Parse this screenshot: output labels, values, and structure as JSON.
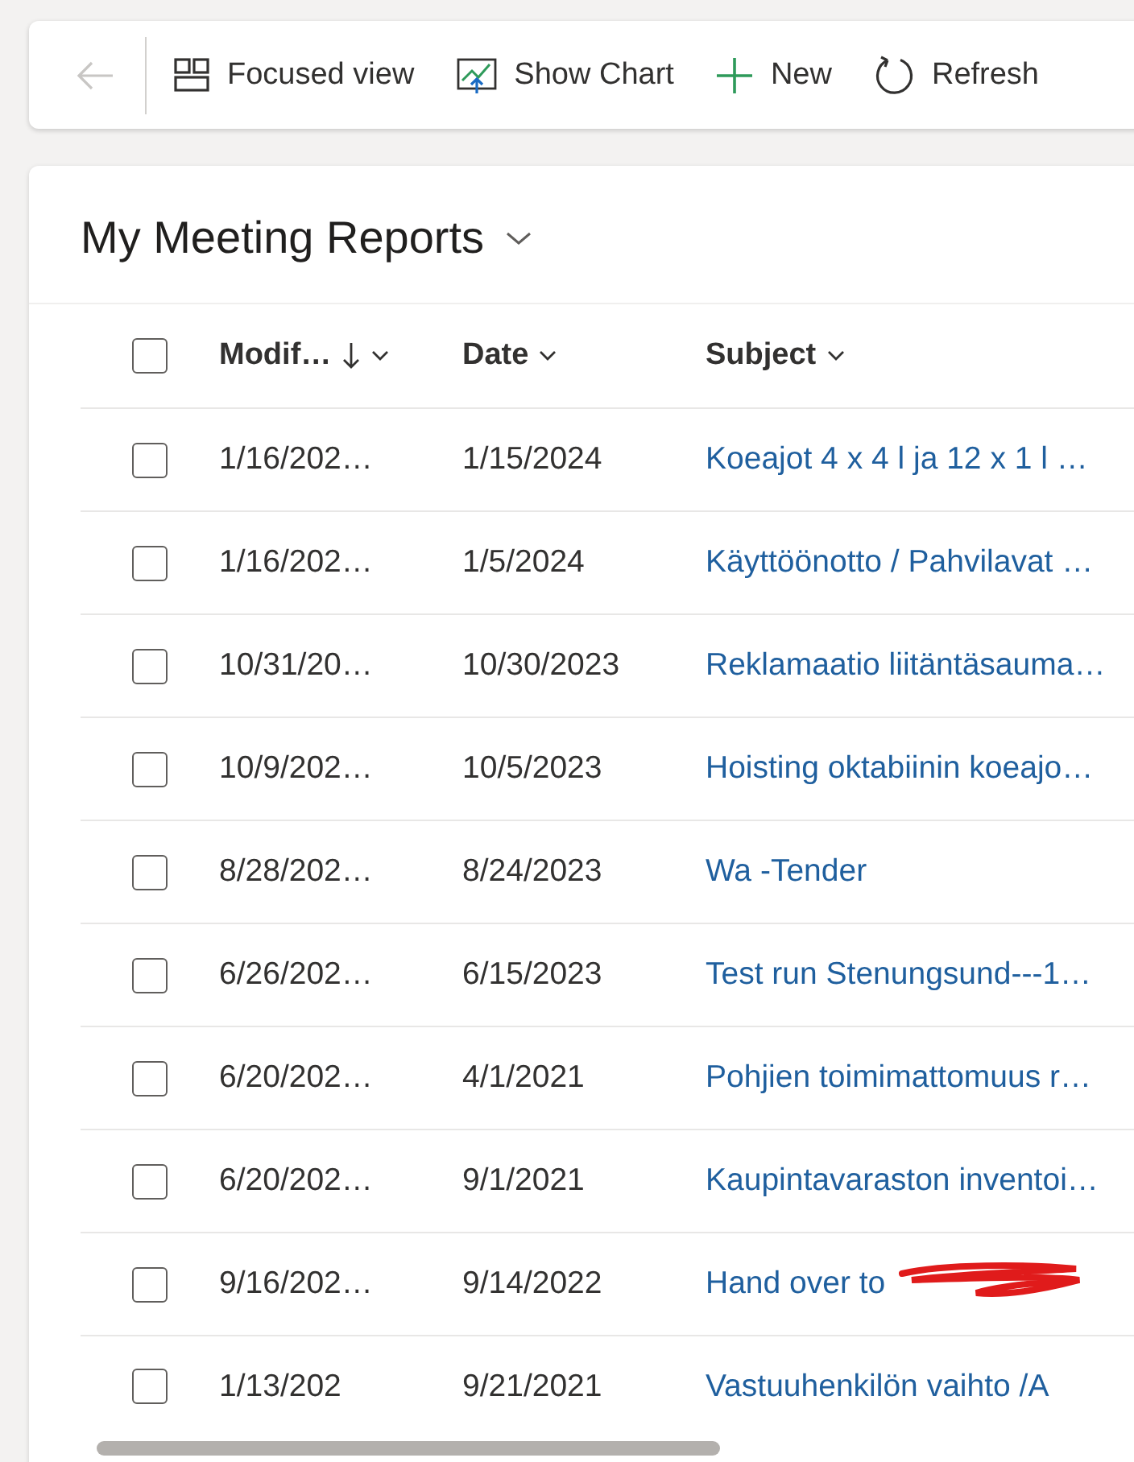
{
  "toolbar": {
    "back": {
      "disabled": true
    },
    "items": [
      {
        "kind": "focused",
        "label": "Focused view"
      },
      {
        "kind": "chart",
        "label": "Show Chart"
      },
      {
        "kind": "new",
        "label": "New"
      },
      {
        "kind": "refresh",
        "label": "Refresh"
      }
    ]
  },
  "view": {
    "title": "My Meeting Reports"
  },
  "table": {
    "all_checked": false,
    "columns": [
      {
        "label": "Modif…",
        "sorted": true
      },
      {
        "label": "Date",
        "sorted": false
      },
      {
        "label": "Subject",
        "sorted": false
      }
    ],
    "rows": [
      {
        "checked": false,
        "modified": "1/16/202…",
        "date": "1/15/2024",
        "subject": "Koeajot 4 x 4 l ja 12 x 1 l …",
        "redacted": false
      },
      {
        "checked": false,
        "modified": "1/16/202…",
        "date": "1/5/2024",
        "subject": "Käyttöönotto / Pahvilavat …",
        "redacted": false
      },
      {
        "checked": false,
        "modified": "10/31/20…",
        "date": "10/30/2023",
        "subject": "Reklamaatio liitäntäsauma…",
        "redacted": false
      },
      {
        "checked": false,
        "modified": "10/9/202…",
        "date": "10/5/2023",
        "subject": "Hoisting oktabiinin koeajo…",
        "redacted": false
      },
      {
        "checked": false,
        "modified": "8/28/202…",
        "date": "8/24/2023",
        "subject": "Wa -Tender",
        "redacted": false
      },
      {
        "checked": false,
        "modified": "6/26/202…",
        "date": "6/15/2023",
        "subject": "Test run Stenungsund---1…",
        "redacted": false
      },
      {
        "checked": false,
        "modified": "6/20/202…",
        "date": "4/1/2021",
        "subject": "Pohjien toimimattomuus r…",
        "redacted": false
      },
      {
        "checked": false,
        "modified": "6/20/202…",
        "date": "9/1/2021",
        "subject": "Kaupintavaraston inventoi…",
        "redacted": false
      },
      {
        "checked": false,
        "modified": "9/16/202…",
        "date": "9/14/2022",
        "subject": "Hand over to",
        "redacted": true
      },
      {
        "checked": false,
        "modified": "1/13/202",
        "date": "9/21/2021",
        "subject": "Vastuuhenkilön vaihto /A",
        "redacted": false
      }
    ]
  }
}
